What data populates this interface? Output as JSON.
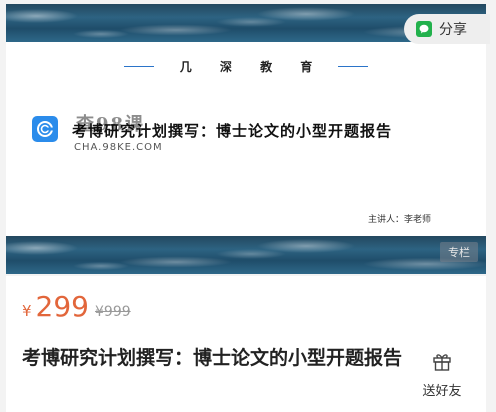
{
  "banner": {
    "brand": "几 深 教 育",
    "course_title": "考博研究计划撰写：博士论文的小型开题报告",
    "watermark": "查98课",
    "watermark_url": "CHA.98KE.COM",
    "lecturer": "主讲人：李老师",
    "column_tag": "专栏"
  },
  "share": {
    "label": "分享",
    "icon": "wechat-icon"
  },
  "price": {
    "currency": "¥",
    "current": "299",
    "original": "¥999"
  },
  "course": {
    "title": "考博研究计划撰写：博士论文的小型开题报告"
  },
  "gift": {
    "label": "送好友",
    "icon": "gift-icon"
  },
  "colors": {
    "accent": "#e2663b",
    "brand_line": "#2b74c9",
    "share_icon": "#22b14c",
    "logo": "#2b8ceb"
  }
}
